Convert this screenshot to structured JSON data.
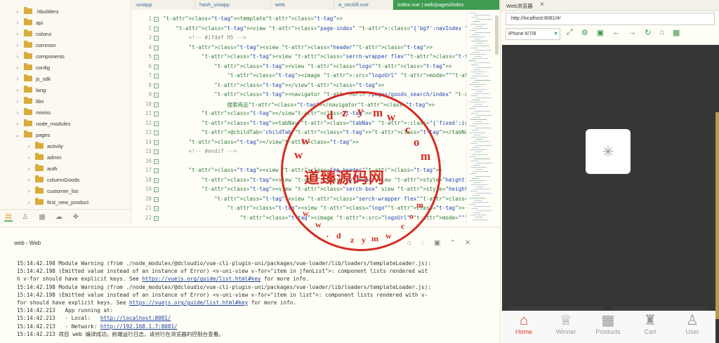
{
  "sidebar": {
    "items": [
      {
        "label": ".hbuilderx",
        "expanded": false
      },
      {
        "label": "api",
        "expanded": false
      },
      {
        "label": "colorui",
        "expanded": false
      },
      {
        "label": "common",
        "expanded": false
      },
      {
        "label": "components",
        "expanded": false
      },
      {
        "label": "config",
        "expanded": false
      },
      {
        "label": "js_sdk",
        "expanded": false
      },
      {
        "label": "lang",
        "expanded": false
      },
      {
        "label": "libs",
        "expanded": false
      },
      {
        "label": "mixins",
        "expanded": false
      },
      {
        "label": "node_modules",
        "expanded": false
      },
      {
        "label": "pages",
        "expanded": true
      },
      {
        "label": "activity",
        "expanded": false
      },
      {
        "label": "admin",
        "expanded": false
      },
      {
        "label": "auth",
        "expanded": false
      },
      {
        "label": "columnGoods",
        "expanded": false
      },
      {
        "label": "customer_list",
        "expanded": false
      },
      {
        "label": "first_new_product",
        "expanded": false
      }
    ]
  },
  "tabs": [
    "uniapp",
    "hash_uniapp",
    "web",
    "a_seckill.vue",
    "index.vue | web/pages/index"
  ],
  "editor": {
    "lines": [
      {
        "n": "1",
        "text": "<template>"
      },
      {
        "n": "2",
        "text": "    <view class=\"page-index\" :class=\"{'bgf':navIndex >0}\">"
      },
      {
        "n": "3",
        "text": "        <!-- #ifdef H5 -->"
      },
      {
        "n": "4",
        "text": "        <view class=\"header\">"
      },
      {
        "n": "5",
        "text": "            <view class=\"serch-wrapper flex\">"
      },
      {
        "n": "6",
        "text": "                <view class=\"logo\">"
      },
      {
        "n": "7",
        "text": "                    <image :src=\"logoUrl\" mode=\"\"></image>"
      },
      {
        "n": "8",
        "text": "                </view>"
      },
      {
        "n": "9",
        "text": "                <navigator url=\"/pages/goods_search/index\" class=\"input\" hover-class"
      },
      {
        "n": "10",
        "text": "                    搜索商品</navigator>"
      },
      {
        "n": "11",
        "text": "            </view>"
      },
      {
        "n": "12",
        "text": "            <tabNav class=\"tabNav\" :class=\"{'fixed':isFixed}\" :tabTitle=\"navTop\" @"
      },
      {
        "n": "13",
        "text": "            @childTab='childTab'></tabNav>"
      },
      {
        "n": "14",
        "text": "        </view>"
      },
      {
        "n": "15",
        "text": "        <!-- #endif -->"
      },
      {
        "n": "16",
        "text": ""
      },
      {
        "n": "17",
        "text": "        <view class=\"mp-header\">"
      },
      {
        "n": "18",
        "text": "            <view class=\"sys-head\" view style=\"height:statusHeight\"></view"
      },
      {
        "n": "19",
        "text": "            <view class=\"serch-box\" view style=\"height: 43px;\">"
      },
      {
        "n": "20",
        "text": "                <view class=\"serch-wrapper flex\">"
      },
      {
        "n": "21",
        "text": "                    <view class=\"logo\">"
      },
      {
        "n": "22",
        "text": "                        <image :src=\"logoUrl\" mode=\"\"></image>"
      }
    ]
  },
  "console": {
    "tab_label": "web - Web",
    "lines": [
      "15:14:42.198 Module Warning (from ./node_modules/@dcloudio/vue-cli-plugin-uni/packages/vue-loader/lib/loaders/templateLoader.js):",
      "15:14:42.198 (Emitted value instead of an instance of Error) <v-uni-view v-for=\"item in jfenList\">: component lists rendered wit",
      "h v-for should have explicit keys. See https://vuejs.org/guide/list.html#key for more info.",
      "15:14:42.198 Module Warning (from ./node_modules/@dcloudio/vue-cli-plugin-uni/packages/vue-loader/lib/loaders/templateLoader.js):",
      "15:14:42.198 (Emitted value instead of an instance of Error) <v-uni-view v-for=\"item in list\">: component lists rendered with v-",
      "for should have explicit keys. See https://vuejs.org/guide/list.html#key for more info.",
      "15:14:42.213   App running at:",
      "15:14:42.213   - Local:   http://localhost:8081/",
      "15:14:42.213   - Network: http://192.168.1.7:8081/",
      "15:14:42.213 项目 web 编译成功。前端运行日志，请另行在浏览器的控制台查看。"
    ],
    "links": [
      "https://vuejs.org/guide/list.html#key",
      "http://localhost:8081/",
      "http://192.168.1.7:8081/"
    ]
  },
  "stamp": {
    "main": "道臻源码网",
    "text": "dzym w.com",
    "small_text": "w w. d z y m . c o m"
  },
  "browser": {
    "tab_title": "Web浏览器",
    "url": "http://localhost:8081/#/",
    "device": "iPhone 6/7/8",
    "tools": [
      "screenshot-icon",
      "settings-icon",
      "console-icon",
      "back-icon",
      "forward-icon",
      "refresh-icon",
      "lock-icon",
      "qr-icon"
    ],
    "nav": [
      "Home",
      "Winner",
      "Products",
      "Cart",
      "User"
    ],
    "active_nav": "Home"
  }
}
